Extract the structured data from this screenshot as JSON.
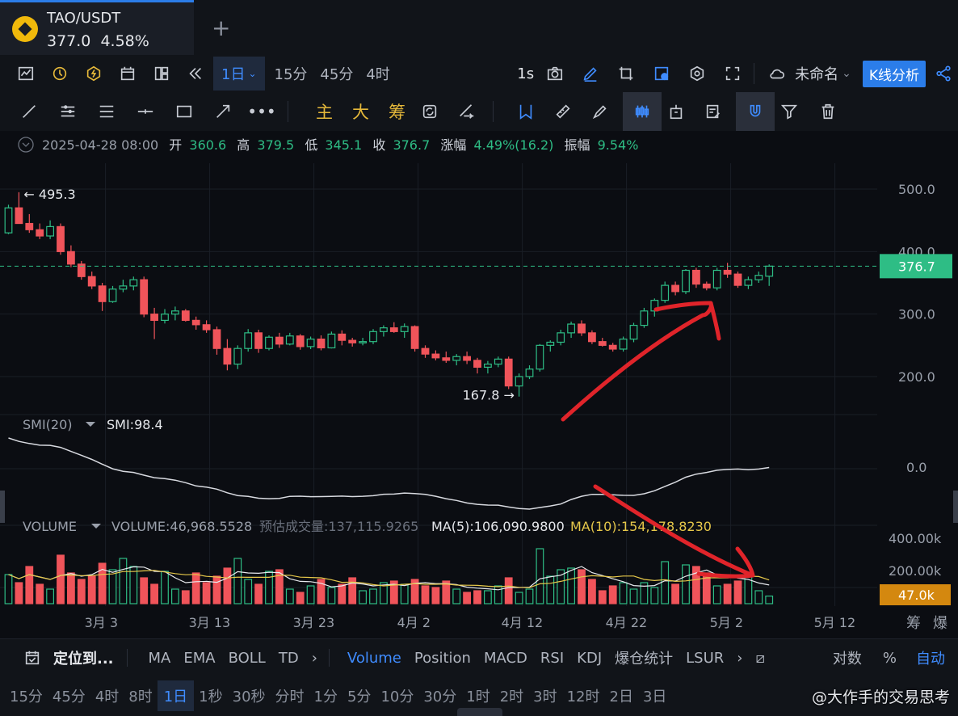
{
  "tab": {
    "symbol": "TAO/USDT",
    "price": "377.0",
    "change": "4.58%",
    "add": "+"
  },
  "toolbar1": {
    "period_active": "1日",
    "periods": [
      "15分",
      "45分",
      "4时"
    ],
    "seconds": "1s",
    "layout_name": "未命名",
    "k_analysis": "K线分析"
  },
  "toolbar2": {
    "main": "主",
    "big": "大",
    "chip": "筹"
  },
  "info": {
    "date": "2025-04-28 08:00",
    "open_label": "开",
    "open": "360.6",
    "high_label": "高",
    "high": "379.5",
    "low_label": "低",
    "low": "345.1",
    "close_label": "收",
    "close": "376.7",
    "chg_label": "涨幅",
    "chg": "4.49%(16.2)",
    "amp_label": "振幅",
    "amp": "9.54%"
  },
  "smi": {
    "label": "SMI(20)",
    "value": "SMI:98.4",
    "axis": "0.0"
  },
  "volume": {
    "label": "VOLUME",
    "value": "VOLUME:46,968.5528",
    "est": "预估成交量:137,115.9265",
    "ma5": "MA(5):106,090.9800",
    "ma10": "MA(10):154,178.8230",
    "axis": [
      "400.00k",
      "200.00k"
    ],
    "current": "47.0k"
  },
  "colors": {
    "up": "#2ebd85",
    "down": "#f0545a",
    "accent": "#3f8cff",
    "ma10": "#e6c84a",
    "annot": "#e0242a"
  },
  "chart_data": {
    "type": "candlestick",
    "price_axis": [
      "500.0",
      "400.0",
      "300.0",
      "200.0"
    ],
    "price_ylim": [
      125,
      535
    ],
    "current_price": "376.7",
    "max_label": "← 495.3",
    "min_label": "167.8 →",
    "x_ticks": [
      {
        "label": "3月 3",
        "i": 9
      },
      {
        "label": "3月 13",
        "i": 19
      },
      {
        "label": "3月 23",
        "i": 29
      },
      {
        "label": "4月 2",
        "i": 39
      },
      {
        "label": "4月 12",
        "i": 49
      },
      {
        "label": "4月 22",
        "i": 59
      },
      {
        "label": "5月 2",
        "i": 69
      },
      {
        "label": "5月 12",
        "i": 79
      }
    ],
    "right_labels": [
      "筹",
      "爆"
    ],
    "ohlc": [
      [
        430,
        475,
        428,
        470
      ],
      [
        470,
        495,
        455,
        445
      ],
      [
        445,
        460,
        430,
        435
      ],
      [
        435,
        445,
        420,
        425
      ],
      [
        425,
        450,
        420,
        440
      ],
      [
        440,
        445,
        395,
        400
      ],
      [
        400,
        410,
        375,
        380
      ],
      [
        380,
        385,
        355,
        360
      ],
      [
        360,
        368,
        340,
        345
      ],
      [
        345,
        350,
        305,
        320
      ],
      [
        320,
        345,
        318,
        340
      ],
      [
        340,
        355,
        335,
        345
      ],
      [
        345,
        360,
        338,
        355
      ],
      [
        355,
        360,
        295,
        300
      ],
      [
        300,
        310,
        260,
        290
      ],
      [
        290,
        308,
        285,
        300
      ],
      [
        300,
        312,
        290,
        305
      ],
      [
        305,
        308,
        288,
        290
      ],
      [
        290,
        296,
        275,
        283
      ],
      [
        283,
        290,
        270,
        275
      ],
      [
        275,
        280,
        235,
        245
      ],
      [
        245,
        260,
        210,
        220
      ],
      [
        220,
        250,
        212,
        245
      ],
      [
        245,
        276,
        240,
        270
      ],
      [
        270,
        275,
        238,
        245
      ],
      [
        245,
        266,
        242,
        263
      ],
      [
        263,
        270,
        246,
        252
      ],
      [
        252,
        270,
        250,
        265
      ],
      [
        265,
        268,
        243,
        248
      ],
      [
        248,
        264,
        244,
        260
      ],
      [
        260,
        266,
        242,
        246
      ],
      [
        246,
        272,
        245,
        268
      ],
      [
        268,
        274,
        250,
        258
      ],
      [
        258,
        262,
        248,
        254
      ],
      [
        254,
        262,
        250,
        256
      ],
      [
        256,
        276,
        252,
        272
      ],
      [
        272,
        282,
        264,
        278
      ],
      [
        278,
        287,
        270,
        272
      ],
      [
        272,
        285,
        262,
        280
      ],
      [
        280,
        282,
        240,
        245
      ],
      [
        245,
        250,
        230,
        236
      ],
      [
        236,
        242,
        226,
        230
      ],
      [
        230,
        240,
        222,
        226
      ],
      [
        226,
        236,
        218,
        232
      ],
      [
        232,
        240,
        220,
        226
      ],
      [
        226,
        230,
        205,
        215
      ],
      [
        215,
        225,
        205,
        220
      ],
      [
        220,
        232,
        215,
        228
      ],
      [
        228,
        232,
        180,
        185
      ],
      [
        185,
        205,
        168,
        200
      ],
      [
        200,
        218,
        196,
        212
      ],
      [
        212,
        252,
        208,
        250
      ],
      [
        250,
        258,
        240,
        255
      ],
      [
        255,
        275,
        250,
        270
      ],
      [
        270,
        288,
        262,
        284
      ],
      [
        284,
        290,
        265,
        270
      ],
      [
        270,
        274,
        252,
        256
      ],
      [
        256,
        262,
        248,
        250
      ],
      [
        250,
        254,
        240,
        244
      ],
      [
        244,
        264,
        240,
        260
      ],
      [
        260,
        286,
        255,
        282
      ],
      [
        282,
        310,
        278,
        305
      ],
      [
        305,
        325,
        296,
        322
      ],
      [
        322,
        352,
        318,
        346
      ],
      [
        346,
        352,
        330,
        336
      ],
      [
        336,
        372,
        332,
        370
      ],
      [
        370,
        374,
        342,
        348
      ],
      [
        348,
        352,
        338,
        342
      ],
      [
        342,
        374,
        338,
        370
      ],
      [
        370,
        382,
        358,
        364
      ],
      [
        364,
        368,
        342,
        346
      ],
      [
        346,
        360,
        340,
        355
      ],
      [
        355,
        368,
        350,
        362
      ],
      [
        360.6,
        379.5,
        345.1,
        376.7
      ]
    ],
    "volume_k": [
      180,
      130,
      230,
      120,
      90,
      300,
      190,
      150,
      170,
      250,
      210,
      280,
      230,
      160,
      120,
      200,
      90,
      80,
      190,
      130,
      170,
      220,
      280,
      150,
      120,
      200,
      210,
      90,
      70,
      110,
      150,
      100,
      120,
      160,
      80,
      90,
      130,
      140,
      120,
      150,
      110,
      100,
      140,
      90,
      70,
      80,
      80,
      110,
      160,
      70,
      90,
      340,
      170,
      210,
      220,
      210,
      150,
      80,
      110,
      130,
      90,
      130,
      100,
      260,
      120,
      240,
      230,
      190,
      110,
      120,
      140,
      190,
      80,
      47
    ],
    "annotations": [
      "up-arrow",
      "down-arrow"
    ]
  },
  "bottom1": {
    "locate": "定位到...",
    "inds1": [
      "MA",
      "EMA",
      "BOLL",
      "TD"
    ],
    "inds2": [
      "Volume",
      "Position",
      "MACD",
      "RSI",
      "KDJ",
      "爆仓统计",
      "LSUR"
    ],
    "log": "对数",
    "pct": "%",
    "auto": "自动"
  },
  "bottom2": {
    "periods": [
      "15分",
      "45分",
      "4时",
      "8时",
      "1日",
      "1秒",
      "30秒",
      "分时",
      "1分",
      "5分",
      "10分",
      "30分",
      "1时",
      "2时",
      "3时",
      "12时",
      "2日",
      "3日"
    ],
    "active": "1日",
    "watermark": "@大作手的交易思考"
  }
}
